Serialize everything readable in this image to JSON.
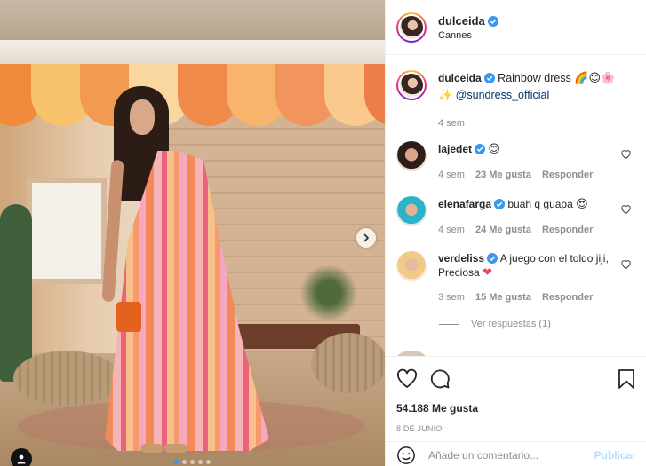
{
  "post": {
    "author": "dulceida",
    "location": "Cannes",
    "caption_text": "Rainbow dress",
    "caption_emojis": "🌈😊🌸",
    "caption_mention_emoji": "✨",
    "caption_mention": "@sundress_official",
    "caption_age": "4 sem",
    "likes": "54.188 Me gusta",
    "date": "8 DE JUNIO"
  },
  "comments": [
    {
      "user": "lajedet",
      "text": "",
      "emoji": "😊",
      "age": "4 sem",
      "likes": "23 Me gusta",
      "reply": "Responder"
    },
    {
      "user": "elenafarga",
      "text": "buah q guapa",
      "emoji": "😍",
      "age": "4 sem",
      "likes": "24 Me gusta",
      "reply": "Responder"
    },
    {
      "user": "verdeliss",
      "text": "A juego con el toldo jiji, Preciosa",
      "emoji": "❤",
      "age": "3 sem",
      "likes": "15 Me gusta",
      "reply": "Responder"
    }
  ],
  "view_replies": "Ver respuestas (1)",
  "add_comment": {
    "placeholder": "Añade un comentario...",
    "publish": "Publicar"
  },
  "carousel": {
    "count": 5,
    "active_index": 0
  },
  "colors": {
    "verified": "#3897f0",
    "link": "#00376b",
    "heart": "#ed4956",
    "publish_disabled": "#b2dffc"
  },
  "icons": [
    "heart-icon",
    "comment-icon",
    "bookmark-icon",
    "verified-badge-icon",
    "chevron-right-icon",
    "emoji-icon",
    "user-tag-icon"
  ]
}
